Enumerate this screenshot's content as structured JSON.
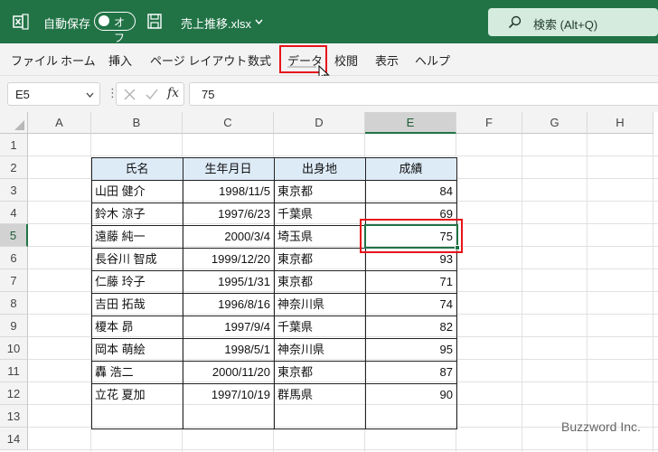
{
  "titlebar": {
    "autosave_label": "自動保存",
    "toggle_label": "オフ",
    "filename": "売上推移.xlsx",
    "search_placeholder": "検索 (Alt+Q)"
  },
  "ribbon": {
    "tabs": [
      "ファイル",
      "ホーム",
      "挿入",
      "ページ レイアウト",
      "数式",
      "データ",
      "校閲",
      "表示",
      "ヘルプ"
    ],
    "highlighted_tab": "データ"
  },
  "formula_bar": {
    "name_box": "E5",
    "fx_label": "fx",
    "value": "75"
  },
  "grid": {
    "columns": [
      "A",
      "B",
      "C",
      "D",
      "E",
      "F",
      "G",
      "H"
    ],
    "rows": [
      "1",
      "2",
      "3",
      "4",
      "5",
      "6",
      "7",
      "8",
      "9",
      "10",
      "11",
      "12",
      "13",
      "14"
    ],
    "selected_cell": "E5"
  },
  "table": {
    "headers": [
      "氏名",
      "生年月日",
      "出身地",
      "成績"
    ],
    "rows": [
      [
        "山田 健介",
        "1998/11/5",
        "東京都",
        "84"
      ],
      [
        "鈴木 涼子",
        "1997/6/23",
        "千葉県",
        "69"
      ],
      [
        "遠藤 純一",
        "2000/3/4",
        "埼玉県",
        "75"
      ],
      [
        "長谷川 智成",
        "1999/12/20",
        "東京都",
        "93"
      ],
      [
        "仁藤 玲子",
        "1995/1/31",
        "東京都",
        "71"
      ],
      [
        "吉田 拓哉",
        "1996/8/16",
        "神奈川県",
        "74"
      ],
      [
        "榎本 昴",
        "1997/9/4",
        "千葉県",
        "82"
      ],
      [
        "岡本 萌絵",
        "1998/5/1",
        "神奈川県",
        "95"
      ],
      [
        "轟 浩二",
        "2000/11/20",
        "東京都",
        "87"
      ],
      [
        "立花 夏加",
        "1997/10/19",
        "群馬県",
        "90"
      ]
    ]
  },
  "watermark": "Buzzword Inc.",
  "colors": {
    "excel_green": "#217346",
    "highlight_red": "#e8141a",
    "header_fill": "#ddebf7"
  }
}
